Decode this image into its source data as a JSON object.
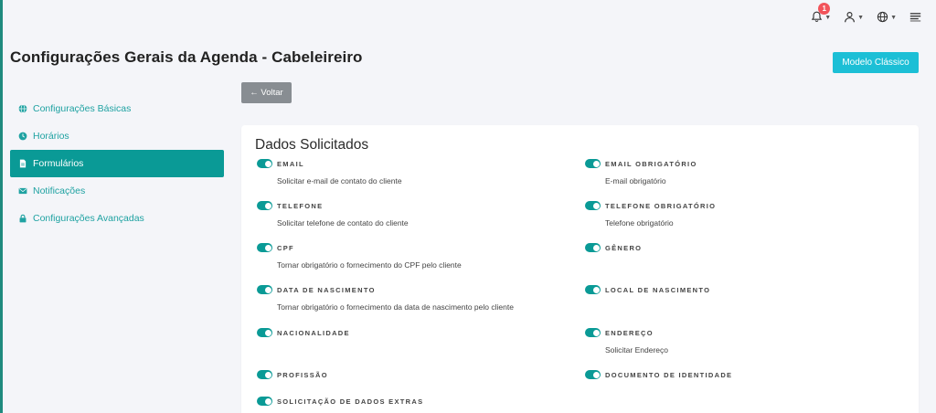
{
  "topbar": {
    "notification_count": "1",
    "icons": [
      "bell-icon",
      "user-icon",
      "globe-icon",
      "menu-icon"
    ]
  },
  "page": {
    "title": "Configurações Gerais da Agenda - Cabeleireiro",
    "classic_button": "Modelo Clássico",
    "back_button": "← Voltar"
  },
  "sidebar": {
    "items": [
      {
        "label": "Configurações Básicas",
        "icon": "globe-icon"
      },
      {
        "label": "Horários",
        "icon": "clock-icon"
      },
      {
        "label": "Formulários",
        "icon": "file-icon",
        "active": true
      },
      {
        "label": "Notificações",
        "icon": "envelope-icon"
      },
      {
        "label": "Configurações Avançadas",
        "icon": "lock-icon"
      }
    ]
  },
  "card": {
    "title": "Dados Solicitados",
    "fields": [
      {
        "label": "EMAIL",
        "desc": "Solicitar e-mail de contato do cliente",
        "enabled": true
      },
      {
        "label": "EMAIL OBRIGATÓRIO",
        "desc": "E-mail obrigatório",
        "enabled": true
      },
      {
        "label": "TELEFONE",
        "desc": "Solicitar telefone de contato do cliente",
        "enabled": true
      },
      {
        "label": "TELEFONE OBRIGATÓRIO",
        "desc": "Telefone obrigatório",
        "enabled": true
      },
      {
        "label": "CPF",
        "desc": "Tornar obrigatório o fornecimento do CPF pelo cliente",
        "enabled": true
      },
      {
        "label": "GÊNERO",
        "desc": "",
        "enabled": true
      },
      {
        "label": "DATA DE NASCIMENTO",
        "desc": "Tornar obrigatório o fornecimento da data de nascimento pelo cliente",
        "enabled": true
      },
      {
        "label": "LOCAL DE NASCIMENTO",
        "desc": "",
        "enabled": true
      },
      {
        "label": "NACIONALIDADE",
        "desc": "",
        "enabled": true
      },
      {
        "label": "ENDEREÇO",
        "desc": "Solicitar Endereço",
        "enabled": true
      },
      {
        "label": "PROFISSÃO",
        "desc": "",
        "enabled": true
      },
      {
        "label": "DOCUMENTO DE IDENTIDADE",
        "desc": "",
        "enabled": true
      },
      {
        "label": "SOLICITAÇÃO DE DADOS EXTRAS",
        "desc": "",
        "enabled": true
      }
    ]
  },
  "colors": {
    "accent": "#0a9a96",
    "link": "#1fa2a2",
    "classic_button": "#1cbfd6",
    "back_button": "#888d92",
    "badge": "#f2545b"
  }
}
